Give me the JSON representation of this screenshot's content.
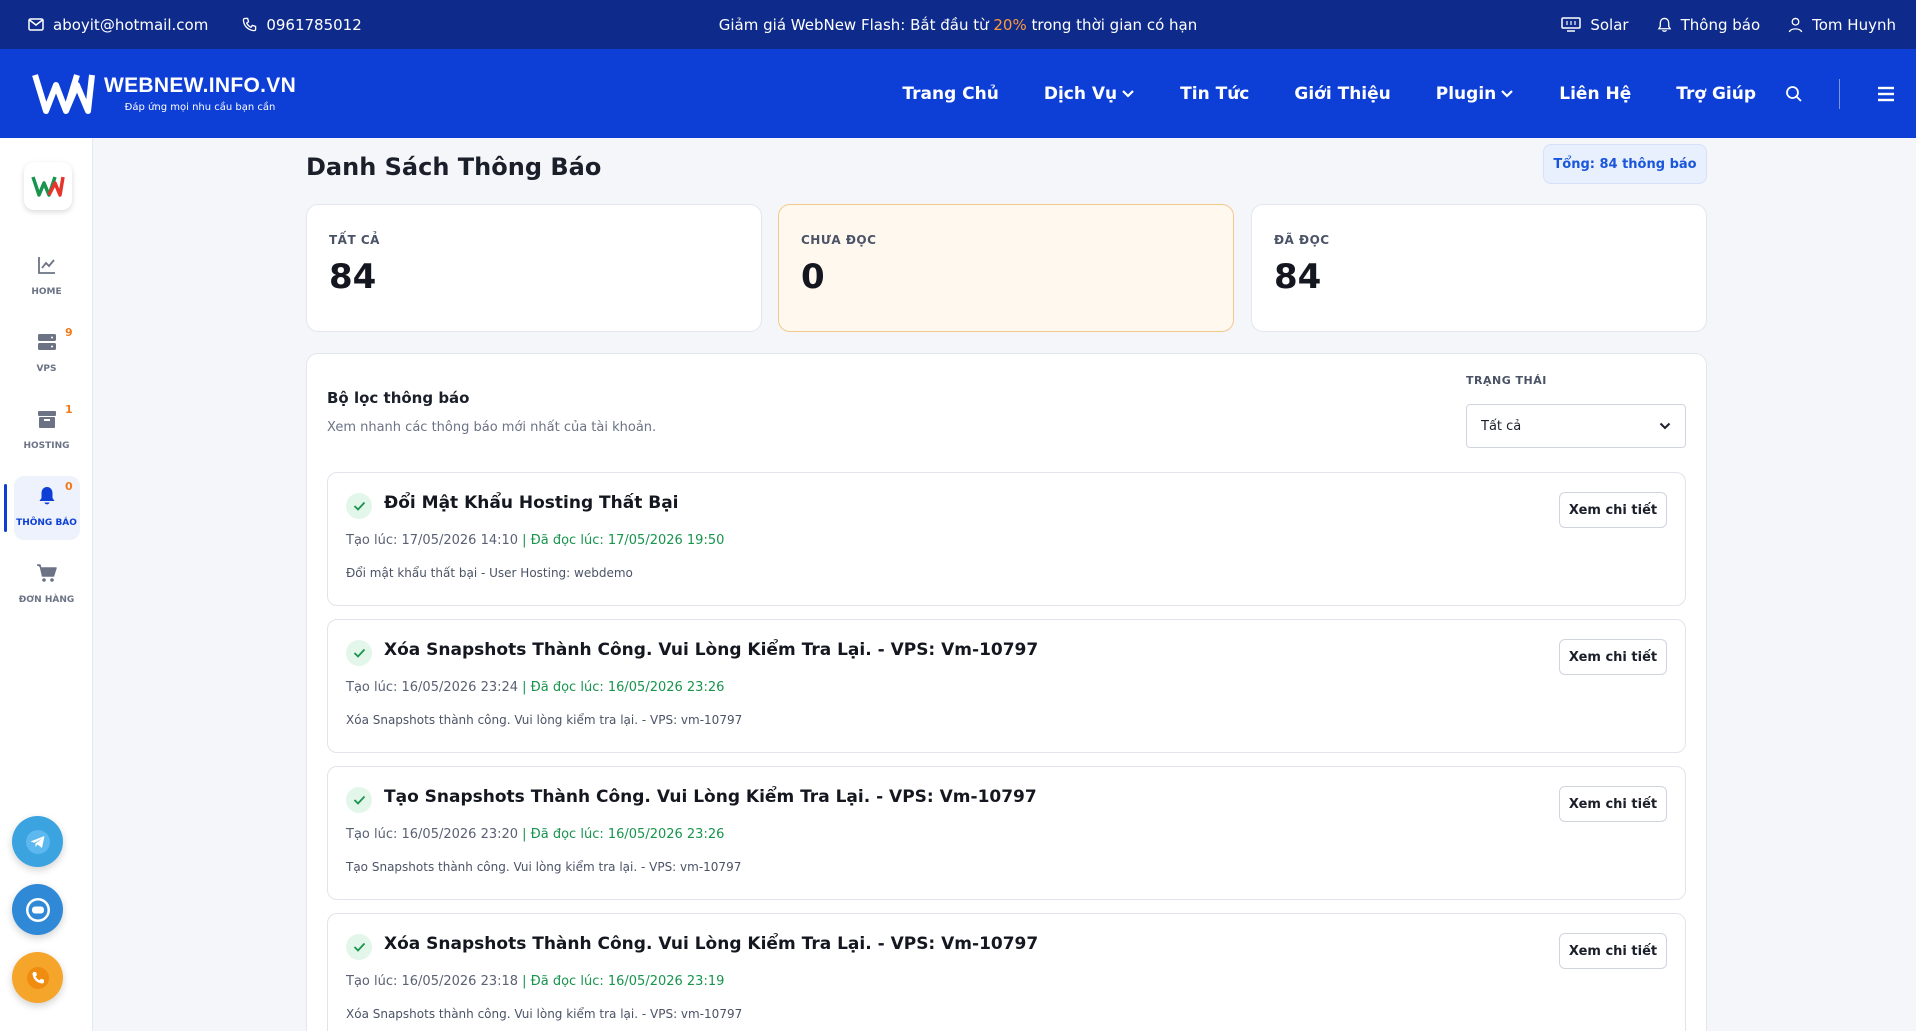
{
  "topbar": {
    "email": "aboyit@hotmail.com",
    "phone": "0961785012",
    "promo_prefix": "Giảm giá WebNew Flash: Bắt đầu từ ",
    "promo_percent": "20%",
    "promo_suffix": " trong thời gian có hạn",
    "solar": "Solar",
    "notifications": "Thông báo",
    "user": "Tom Huynh"
  },
  "logo": {
    "brand": "WEBNEW.INFO.VN",
    "tagline": "Đáp ứng mọi nhu cầu bạn cần"
  },
  "nav": {
    "items": [
      "Trang Chủ",
      "Dịch Vụ",
      "Tin Tức",
      "Giới Thiệu",
      "Plugin",
      "Liên Hệ",
      "Trợ Giúp"
    ]
  },
  "sidebar": {
    "items": [
      {
        "label": "HOME",
        "count": ""
      },
      {
        "label": "VPS",
        "count": "9"
      },
      {
        "label": "HOSTING",
        "count": "1"
      },
      {
        "label": "THÔNG BÁO",
        "count": "0"
      },
      {
        "label": "ĐƠN HÀNG",
        "count": ""
      }
    ]
  },
  "page": {
    "title": "Danh Sách Thông Báo",
    "total": "Tổng: 84 thông báo"
  },
  "stats": {
    "all_label": "TẤT CẢ",
    "all_value": "84",
    "unread_label": "CHƯA ĐỌC",
    "unread_value": "0",
    "read_label": "ĐÃ ĐỌC",
    "read_value": "84"
  },
  "filter": {
    "title": "Bộ lọc thông báo",
    "subtitle": "Xem nhanh các thông báo mới nhất của tài khoản.",
    "status_label": "TRẠNG THÁI",
    "status_value": "Tất cả"
  },
  "notifications": [
    {
      "title": "Đổi Mật Khẩu Hosting Thất Bại",
      "created": "Tạo lúc: 17/05/2026 14:10",
      "read": "| Đã đọc lúc: 17/05/2026 19:50",
      "desc": "Đổi mật khẩu thất bại - User Hosting: webdemo",
      "button": "Xem chi tiết"
    },
    {
      "title": "Xóa Snapshots Thành Công. Vui Lòng Kiểm Tra Lại. - VPS: Vm-10797",
      "created": "Tạo lúc: 16/05/2026 23:24",
      "read": "| Đã đọc lúc: 16/05/2026 23:26",
      "desc": "Xóa Snapshots thành công. Vui lòng kiểm tra lại. - VPS: vm-10797",
      "button": "Xem chi tiết"
    },
    {
      "title": "Tạo Snapshots Thành Công. Vui Lòng Kiểm Tra Lại. - VPS: Vm-10797",
      "created": "Tạo lúc: 16/05/2026 23:20",
      "read": "| Đã đọc lúc: 16/05/2026 23:26",
      "desc": "Tạo Snapshots thành công. Vui lòng kiểm tra lại. - VPS: vm-10797",
      "button": "Xem chi tiết"
    },
    {
      "title": "Xóa Snapshots Thành Công. Vui Lòng Kiểm Tra Lại. - VPS: Vm-10797",
      "created": "Tạo lúc: 16/05/2026 23:18",
      "read": "| Đã đọc lúc: 16/05/2026 23:19",
      "desc": "Xóa Snapshots thành công. Vui lòng kiểm tra lại. - VPS: vm-10797",
      "button": "Xem chi tiết"
    }
  ],
  "colors": {
    "topbar": "#0e2a8a",
    "navbar": "#0d3fd6",
    "accent_orange": "#ff9a3c",
    "read_green": "#18944d"
  }
}
